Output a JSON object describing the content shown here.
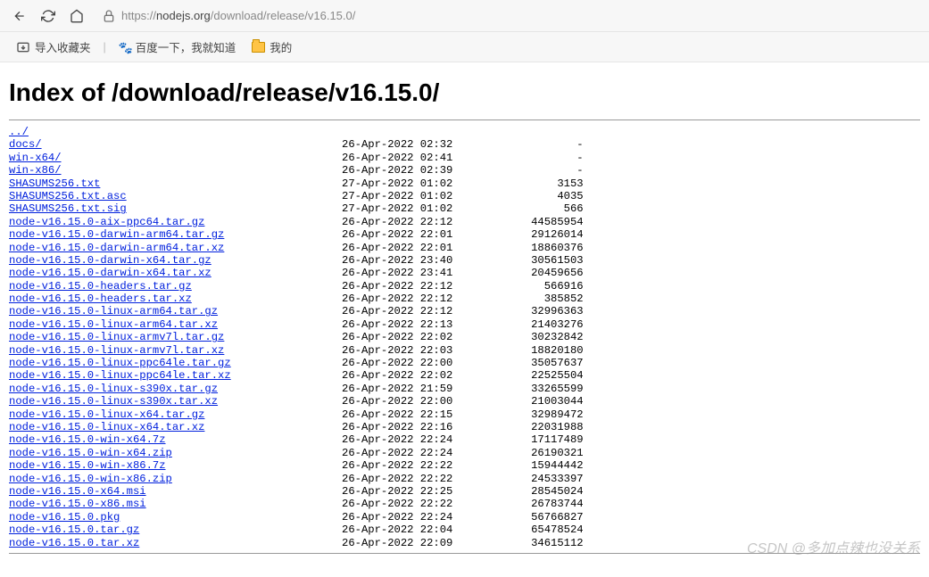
{
  "toolbar": {
    "url_display": "https://nodejs.org/download/release/v16.15.0/",
    "url_prefix": "https://",
    "url_host": "nodejs.org",
    "url_path": "/download/release/v16.15.0/"
  },
  "bookmarks": {
    "import_label": "导入收藏夹",
    "baidu_label": "百度一下，我就知道",
    "mine_label": "我的"
  },
  "page": {
    "heading": "Index of /download/release/v16.15.0/"
  },
  "listing": [
    {
      "name": "../",
      "date": "",
      "size": ""
    },
    {
      "name": "docs/",
      "date": "26-Apr-2022 02:32",
      "size": "-"
    },
    {
      "name": "win-x64/",
      "date": "26-Apr-2022 02:41",
      "size": "-"
    },
    {
      "name": "win-x86/",
      "date": "26-Apr-2022 02:39",
      "size": "-"
    },
    {
      "name": "SHASUMS256.txt",
      "date": "27-Apr-2022 01:02",
      "size": "3153"
    },
    {
      "name": "SHASUMS256.txt.asc",
      "date": "27-Apr-2022 01:02",
      "size": "4035"
    },
    {
      "name": "SHASUMS256.txt.sig",
      "date": "27-Apr-2022 01:02",
      "size": "566"
    },
    {
      "name": "node-v16.15.0-aix-ppc64.tar.gz",
      "date": "26-Apr-2022 22:12",
      "size": "44585954"
    },
    {
      "name": "node-v16.15.0-darwin-arm64.tar.gz",
      "date": "26-Apr-2022 22:01",
      "size": "29126014"
    },
    {
      "name": "node-v16.15.0-darwin-arm64.tar.xz",
      "date": "26-Apr-2022 22:01",
      "size": "18860376"
    },
    {
      "name": "node-v16.15.0-darwin-x64.tar.gz",
      "date": "26-Apr-2022 23:40",
      "size": "30561503"
    },
    {
      "name": "node-v16.15.0-darwin-x64.tar.xz",
      "date": "26-Apr-2022 23:41",
      "size": "20459656"
    },
    {
      "name": "node-v16.15.0-headers.tar.gz",
      "date": "26-Apr-2022 22:12",
      "size": "566916"
    },
    {
      "name": "node-v16.15.0-headers.tar.xz",
      "date": "26-Apr-2022 22:12",
      "size": "385852"
    },
    {
      "name": "node-v16.15.0-linux-arm64.tar.gz",
      "date": "26-Apr-2022 22:12",
      "size": "32996363"
    },
    {
      "name": "node-v16.15.0-linux-arm64.tar.xz",
      "date": "26-Apr-2022 22:13",
      "size": "21403276"
    },
    {
      "name": "node-v16.15.0-linux-armv7l.tar.gz",
      "date": "26-Apr-2022 22:02",
      "size": "30232842"
    },
    {
      "name": "node-v16.15.0-linux-armv7l.tar.xz",
      "date": "26-Apr-2022 22:03",
      "size": "18820180"
    },
    {
      "name": "node-v16.15.0-linux-ppc64le.tar.gz",
      "date": "26-Apr-2022 22:00",
      "size": "35057637"
    },
    {
      "name": "node-v16.15.0-linux-ppc64le.tar.xz",
      "date": "26-Apr-2022 22:02",
      "size": "22525504"
    },
    {
      "name": "node-v16.15.0-linux-s390x.tar.gz",
      "date": "26-Apr-2022 21:59",
      "size": "33265599"
    },
    {
      "name": "node-v16.15.0-linux-s390x.tar.xz",
      "date": "26-Apr-2022 22:00",
      "size": "21003044"
    },
    {
      "name": "node-v16.15.0-linux-x64.tar.gz",
      "date": "26-Apr-2022 22:15",
      "size": "32989472"
    },
    {
      "name": "node-v16.15.0-linux-x64.tar.xz",
      "date": "26-Apr-2022 22:16",
      "size": "22031988"
    },
    {
      "name": "node-v16.15.0-win-x64.7z",
      "date": "26-Apr-2022 22:24",
      "size": "17117489"
    },
    {
      "name": "node-v16.15.0-win-x64.zip",
      "date": "26-Apr-2022 22:24",
      "size": "26190321"
    },
    {
      "name": "node-v16.15.0-win-x86.7z",
      "date": "26-Apr-2022 22:22",
      "size": "15944442"
    },
    {
      "name": "node-v16.15.0-win-x86.zip",
      "date": "26-Apr-2022 22:22",
      "size": "24533397"
    },
    {
      "name": "node-v16.15.0-x64.msi",
      "date": "26-Apr-2022 22:25",
      "size": "28545024"
    },
    {
      "name": "node-v16.15.0-x86.msi",
      "date": "26-Apr-2022 22:22",
      "size": "26783744"
    },
    {
      "name": "node-v16.15.0.pkg",
      "date": "26-Apr-2022 22:24",
      "size": "56766827"
    },
    {
      "name": "node-v16.15.0.tar.gz",
      "date": "26-Apr-2022 22:04",
      "size": "65478524"
    },
    {
      "name": "node-v16.15.0.tar.xz",
      "date": "26-Apr-2022 22:09",
      "size": "34615112"
    }
  ],
  "watermark": "CSDN @多加点辣也没关系"
}
